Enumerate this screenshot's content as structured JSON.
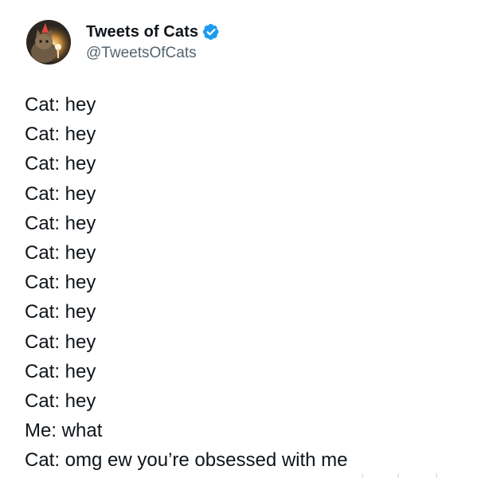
{
  "author": {
    "display_name": "Tweets of Cats",
    "handle": "@TweetsOfCats",
    "verified": true,
    "avatar_icon": "cat-avatar-icon",
    "verified_icon": "verified-badge-icon",
    "verified_color": "#1d9bf0"
  },
  "tweet": {
    "lines": [
      "Cat: hey",
      "Cat: hey",
      "Cat: hey",
      "Cat: hey",
      "Cat: hey",
      "Cat: hey",
      "Cat: hey",
      "Cat: hey",
      "Cat: hey",
      "Cat: hey",
      "Cat: hey",
      "Me: what",
      "Cat: omg ew you’re obsessed with me"
    ]
  },
  "colors": {
    "text": "#0f1419",
    "secondary_text": "#536471",
    "background": "#ffffff"
  }
}
